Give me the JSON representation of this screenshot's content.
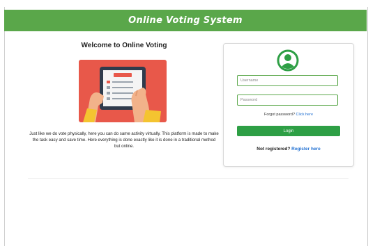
{
  "header": {
    "title": "Online Voting System"
  },
  "welcome": {
    "title": "Welcome to Online Voting",
    "description": "Just like we do vote physically, here you can do same activity virtually. This platform is made to make the task easy and save time. Here everything is done exactly like it is done in a traditional method but online."
  },
  "login": {
    "username_placeholder": "Username",
    "password_placeholder": "Password",
    "forgot_prefix": "Forgot password?",
    "forgot_link": "Click here",
    "login_button": "Login",
    "register_prefix": "Not registered?",
    "register_link": "Register here"
  },
  "colors": {
    "header": "#5aa74a",
    "button": "#2e9f45",
    "link": "#1f6fd1",
    "avatar": "#2e9f45"
  },
  "icons": [
    "user-avatar-icon",
    "voting-tablet-illustration"
  ]
}
